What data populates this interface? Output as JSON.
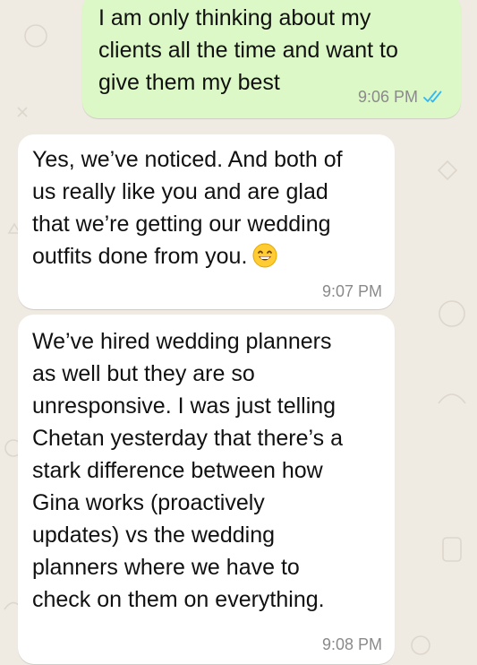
{
  "conversation": {
    "messages": [
      {
        "direction": "outgoing",
        "text": "I am only thinking about my\nclients all the time and want to\ngive them my best",
        "time": "9:06 PM",
        "status": "read-double-check-icon"
      },
      {
        "direction": "incoming",
        "text": "Yes, we’ve noticed. And both of\nus really like you and are glad\nthat we’re getting our wedding\noutfits done from you.",
        "emoji": "😄",
        "time": "9:07 PM"
      },
      {
        "direction": "incoming",
        "text": "We’ve hired wedding planners\nas well but they are so\nunresponsive. I was just telling\nChetan yesterday that there’s a\nstark difference between how\nGina works (proactively\nupdates) vs the wedding\nplanners where we have to\ncheck on them on everything.",
        "time": "9:08 PM"
      }
    ]
  },
  "colors": {
    "background": "#efeae2",
    "outgoing_bubble": "#dcf8c6",
    "incoming_bubble": "#ffffff",
    "read_ticks": "#34b7f1",
    "timestamp": "#8a8a8a"
  }
}
